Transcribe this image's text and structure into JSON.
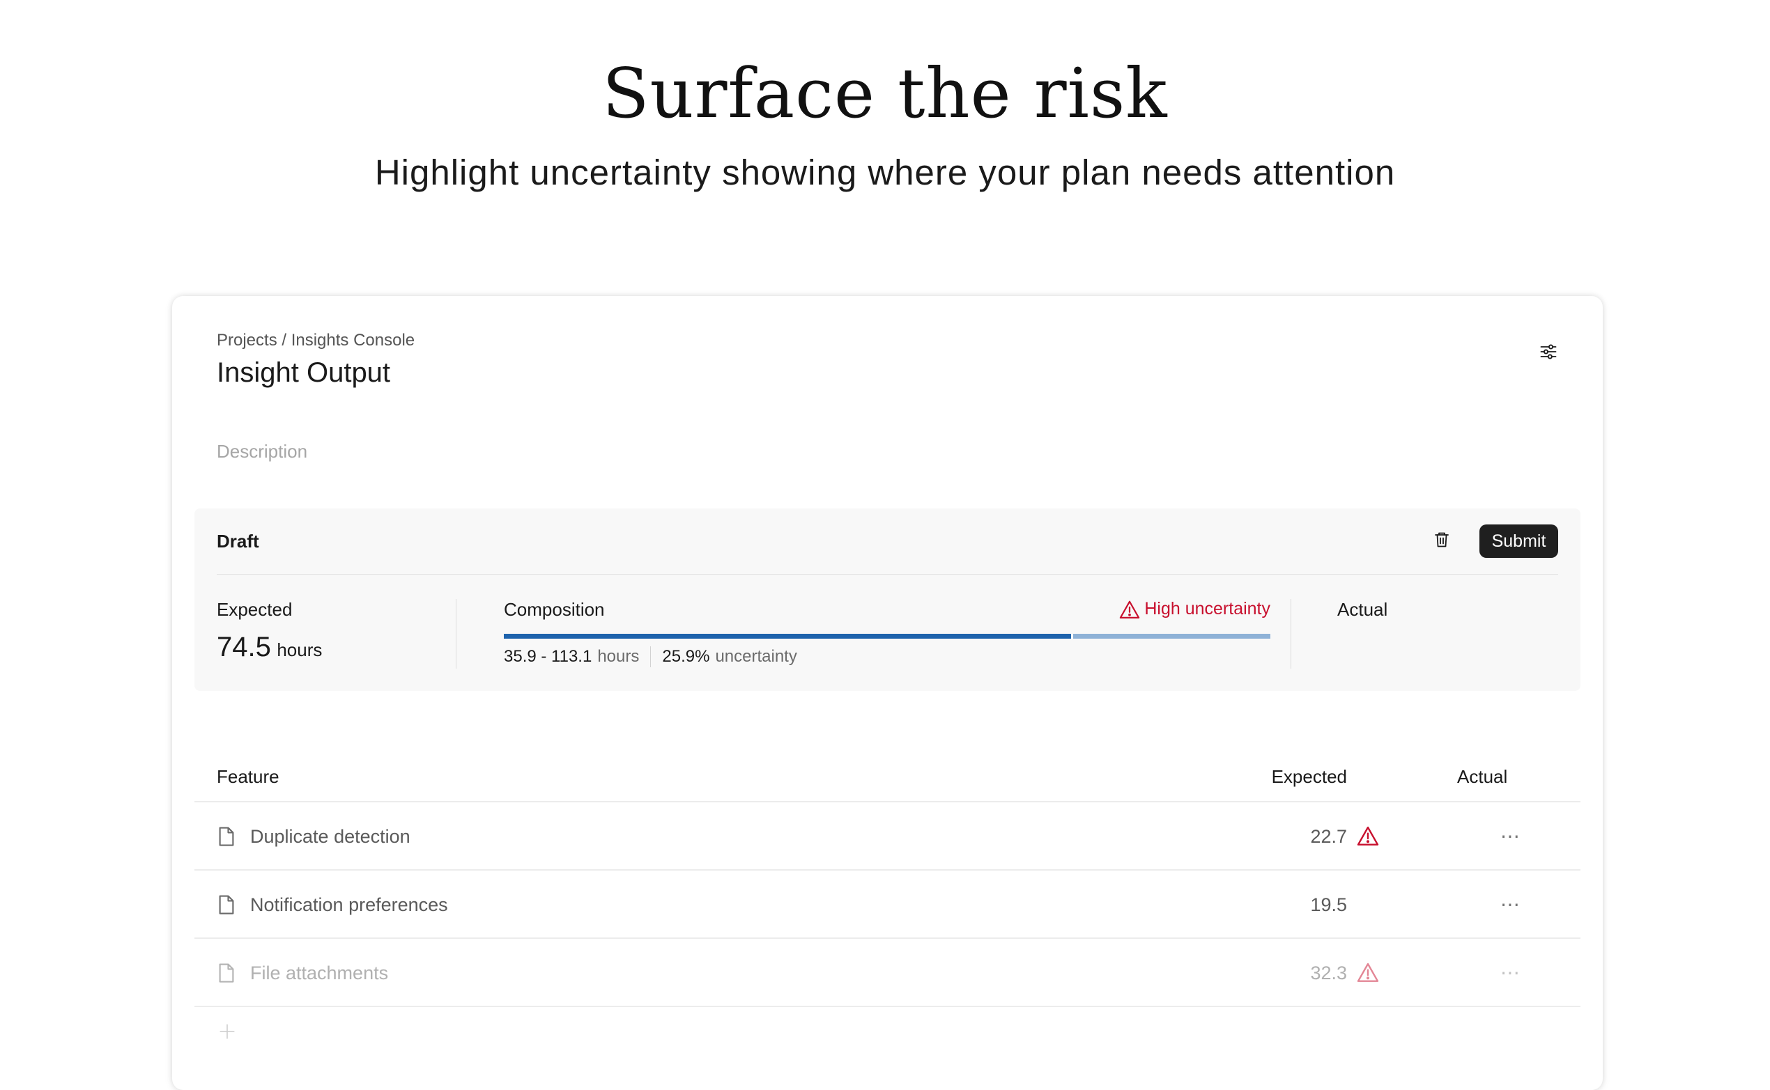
{
  "hero": {
    "title": "Surface the risk",
    "subtitle": "Highlight uncertainty showing where your plan needs attention"
  },
  "header": {
    "breadcrumb": "Projects / Insights Console",
    "title": "Insight Output",
    "description_placeholder": "Description",
    "settings_icon": "sliders-icon"
  },
  "draft": {
    "status_label": "Draft",
    "delete_icon": "trash-icon",
    "submit_label": "Submit",
    "expected": {
      "label": "Expected",
      "value": "74.5",
      "unit": "hours"
    },
    "composition": {
      "label": "Composition",
      "warning_label": "High uncertainty",
      "expected_fraction": 0.74,
      "range_value": "35.9 - 113.1",
      "range_unit": "hours",
      "uncertainty_value": "25.9%",
      "uncertainty_label": "uncertainty"
    },
    "actual": {
      "label": "Actual"
    }
  },
  "table": {
    "columns": {
      "feature": "Feature",
      "expected": "Expected",
      "actual": "Actual"
    },
    "rows": [
      {
        "name": "Duplicate detection",
        "expected": "22.7",
        "warning": true
      },
      {
        "name": "Notification preferences",
        "expected": "19.5",
        "warning": false
      },
      {
        "name": "File attachments",
        "expected": "32.3",
        "warning": true
      }
    ],
    "more_label": "⋯"
  },
  "colors": {
    "accent_blue": "#1e63ad",
    "uncertain_blue": "#8fb2d7",
    "warning_red": "#c8102e",
    "submit_bg": "#1f1f1f"
  }
}
